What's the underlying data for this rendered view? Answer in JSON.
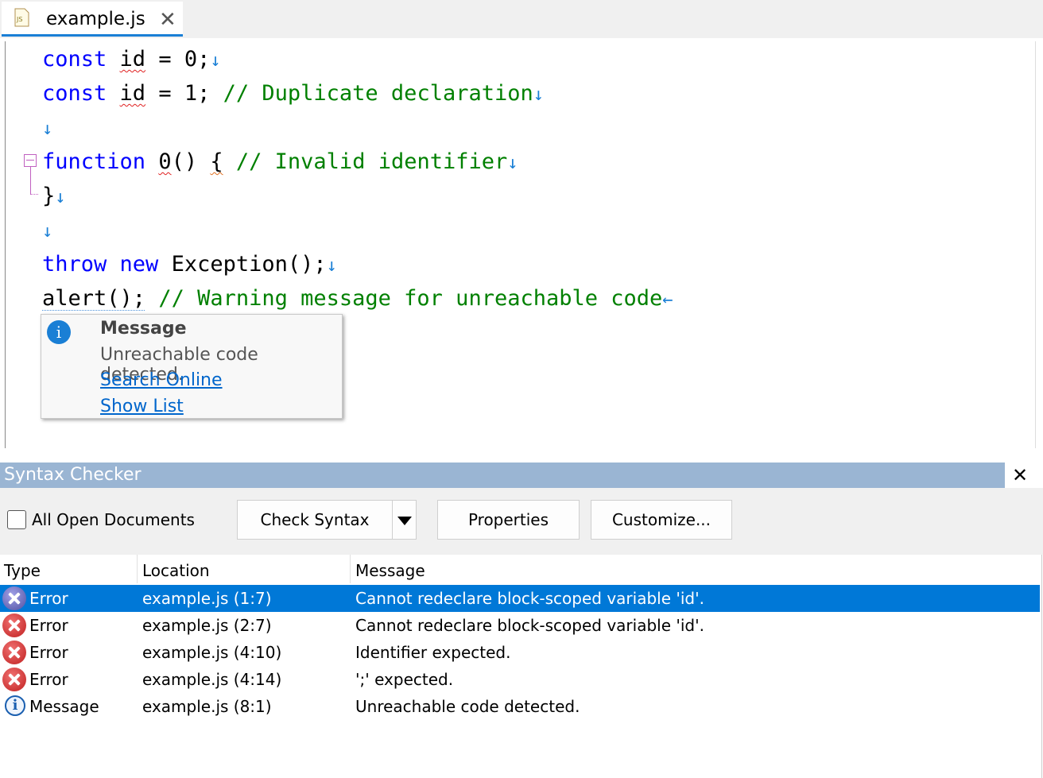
{
  "tab": {
    "title": "example.js",
    "icon_text": "JS",
    "close_glyph": "✕"
  },
  "editor": {
    "eol_down": "↓",
    "eol_left": "←"
  },
  "tooltip": {
    "title": "Message",
    "text": "Unreachable code detected.",
    "link1": "Search Online",
    "link2": "Show List",
    "icon_glyph": "i"
  },
  "panel": {
    "title": "Syntax Checker",
    "close_glyph": "✕",
    "all_docs_label": "All Open Documents",
    "check_syntax": "Check Syntax",
    "properties": "Properties",
    "customize": "Customize..."
  },
  "grid": {
    "columns": [
      "Type",
      "Location",
      "Message"
    ],
    "rows": [
      {
        "type": "Error",
        "location": "example.js (1:7)",
        "message": "Cannot redeclare block-scoped variable 'id'.",
        "icon": "error-icon",
        "selected": true
      },
      {
        "type": "Error",
        "location": "example.js (2:7)",
        "message": "Cannot redeclare block-scoped variable 'id'.",
        "icon": "error-icon",
        "selected": false
      },
      {
        "type": "Error",
        "location": "example.js (4:10)",
        "message": "Identifier expected.",
        "icon": "error-icon",
        "selected": false
      },
      {
        "type": "Error",
        "location": "example.js (4:14)",
        "message": "';' expected.",
        "icon": "error-icon",
        "selected": false
      },
      {
        "type": "Message",
        "location": "example.js (8:1)",
        "message": "Unreachable code detected.",
        "icon": "info-icon",
        "selected": false
      }
    ]
  },
  "colors": {
    "accent": "#0078d7",
    "panel_header": "#9ab5d3",
    "keyword": "#0000ff",
    "comment": "#008000"
  }
}
